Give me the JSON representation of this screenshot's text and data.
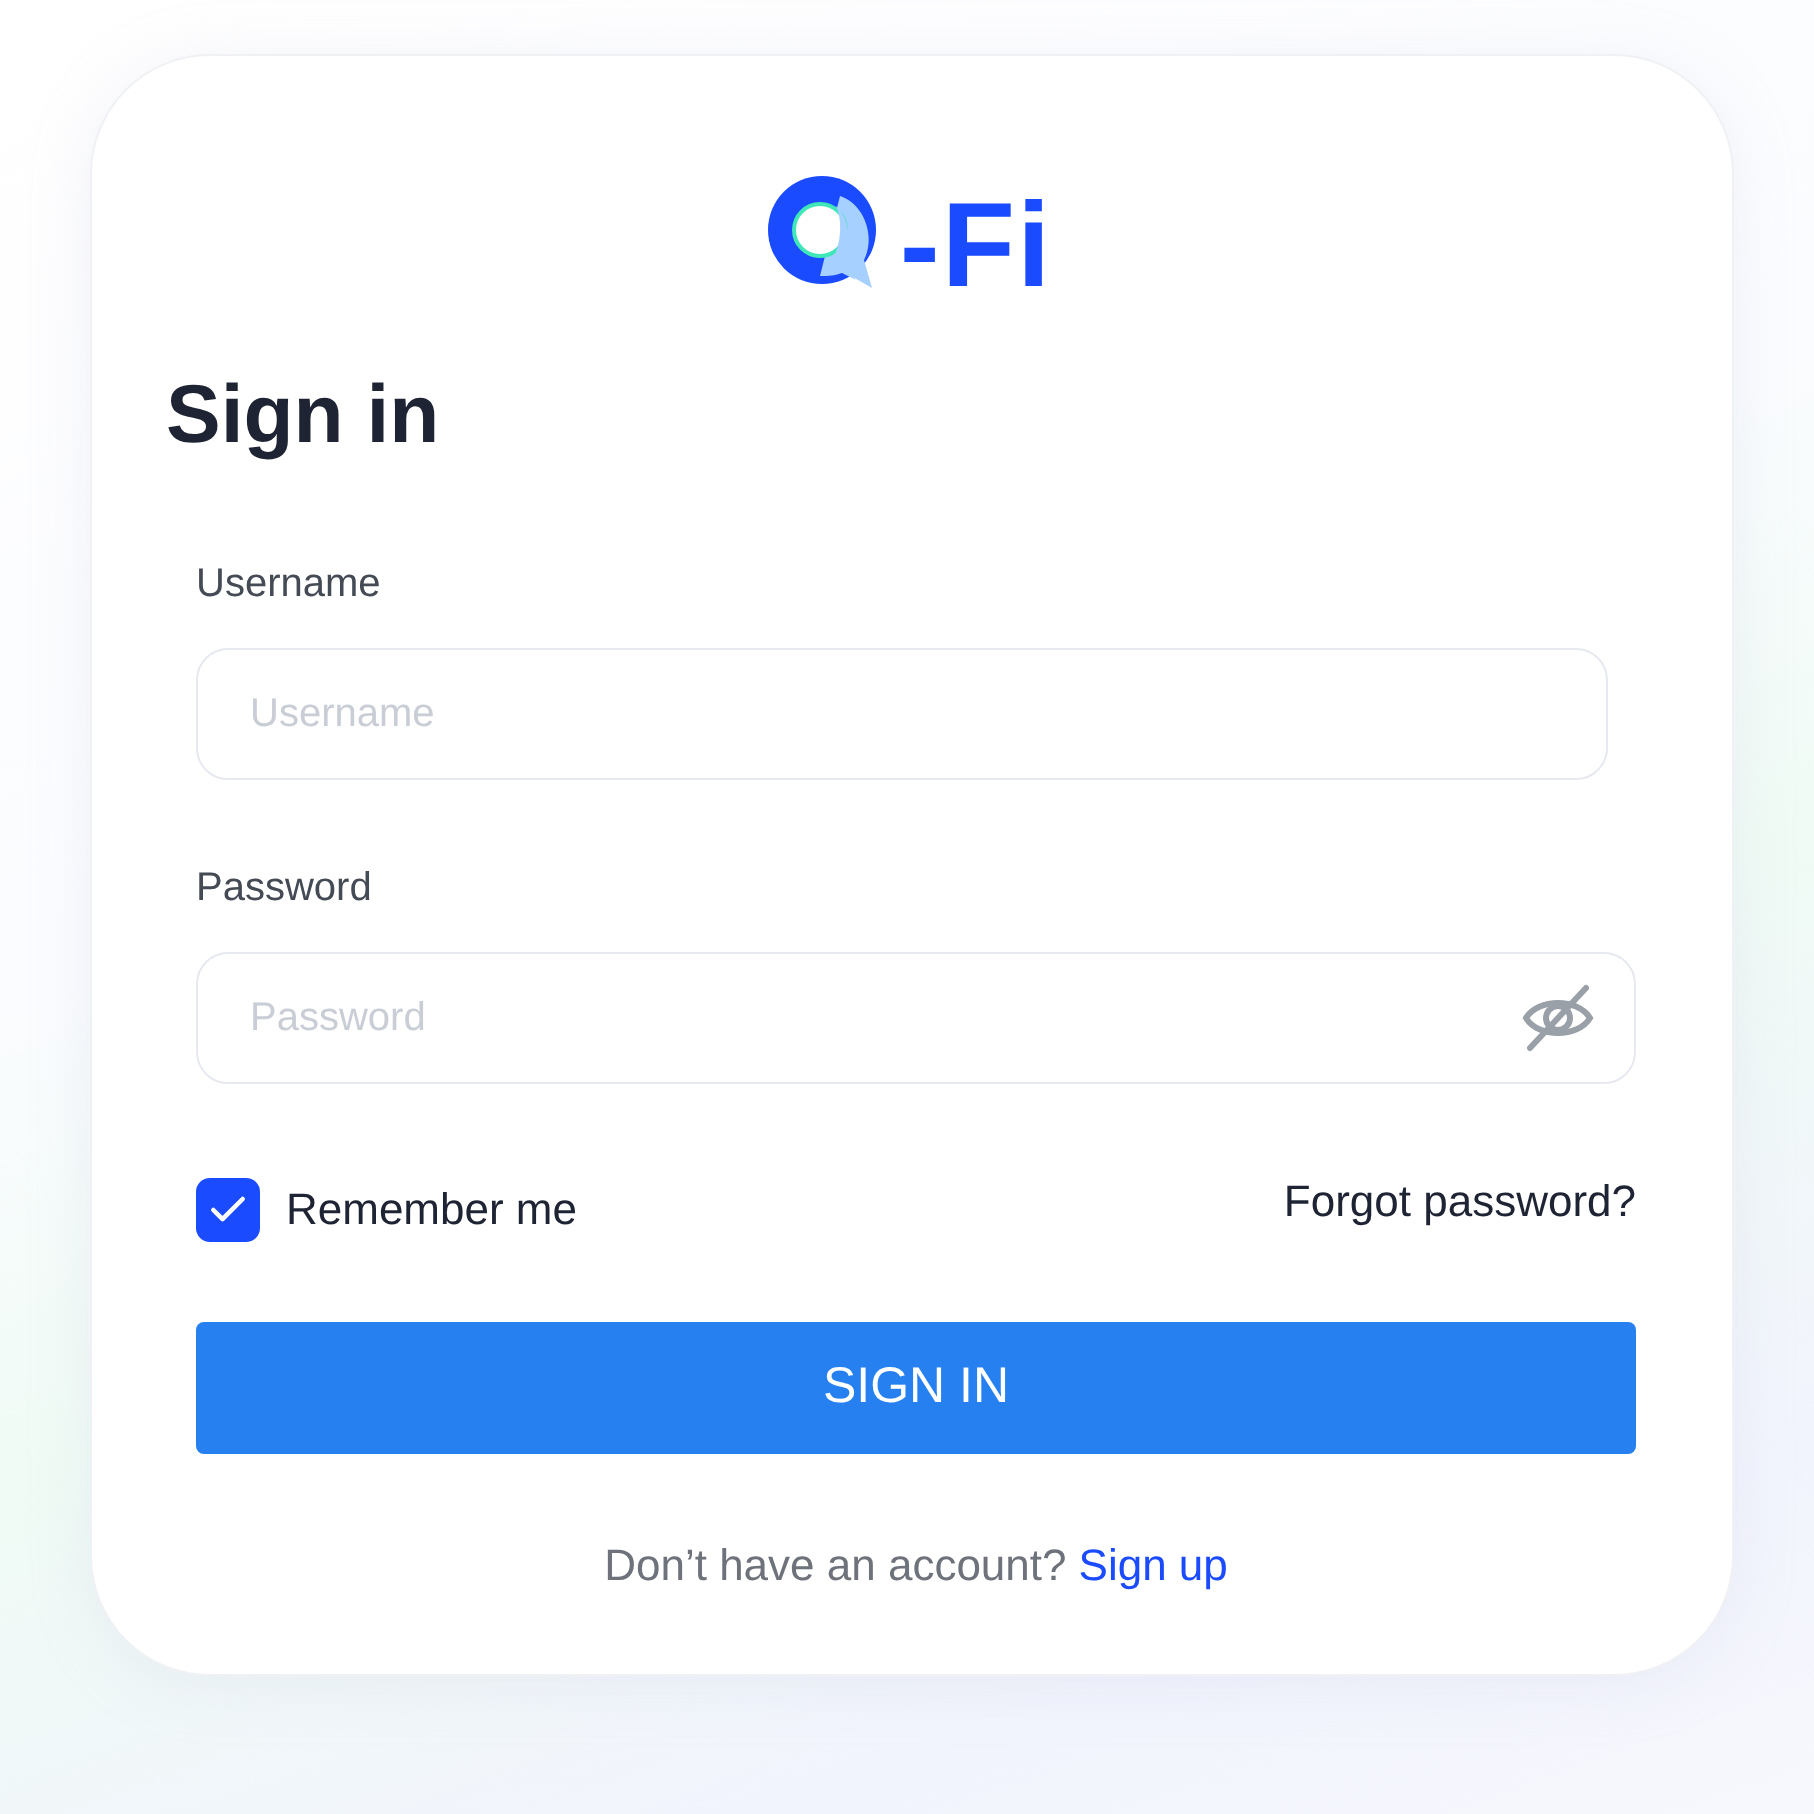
{
  "logo": {
    "text": "-Fi"
  },
  "title": "Sign in",
  "fields": [
    {
      "kind": "text",
      "label": "Username",
      "placeholder": "Username"
    },
    {
      "kind": "password",
      "label": "Password",
      "placeholder": "Password"
    }
  ],
  "remember": {
    "label": "Remember me",
    "checked": true
  },
  "forgot_link": "Forgot password?",
  "submit": "SIGN IN",
  "signup": {
    "prompt": "Don’t have an account?",
    "link": "Sign up"
  }
}
